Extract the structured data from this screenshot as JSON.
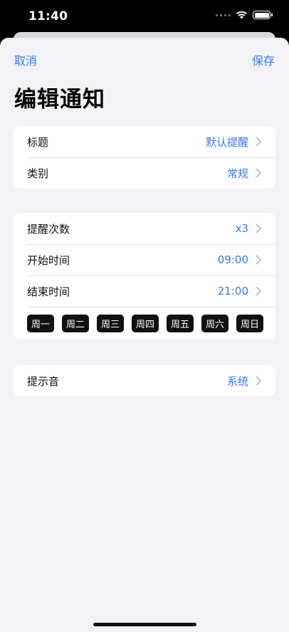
{
  "status_bar": {
    "time": "11:40"
  },
  "nav": {
    "cancel_label": "取消",
    "save_label": "保存"
  },
  "title": "编辑通知",
  "group1": {
    "rows": [
      {
        "label": "标题",
        "value": "默认提醒"
      },
      {
        "label": "类别",
        "value": "常规"
      }
    ]
  },
  "group2": {
    "rows": [
      {
        "label": "提醒次数",
        "value": "x3"
      },
      {
        "label": "开始时间",
        "value": "09:00"
      },
      {
        "label": "结束时间",
        "value": "21:00"
      }
    ],
    "days": [
      "周一",
      "周二",
      "周三",
      "周四",
      "周五",
      "周六",
      "周日"
    ]
  },
  "group3": {
    "rows": [
      {
        "label": "提示音",
        "value": "系统"
      }
    ]
  },
  "colors": {
    "accent": "#3478f6",
    "background": "#f2f2f7",
    "chip": "#111111"
  },
  "icons": [
    "wifi-icon",
    "battery-icon",
    "chevron-right-icon"
  ]
}
